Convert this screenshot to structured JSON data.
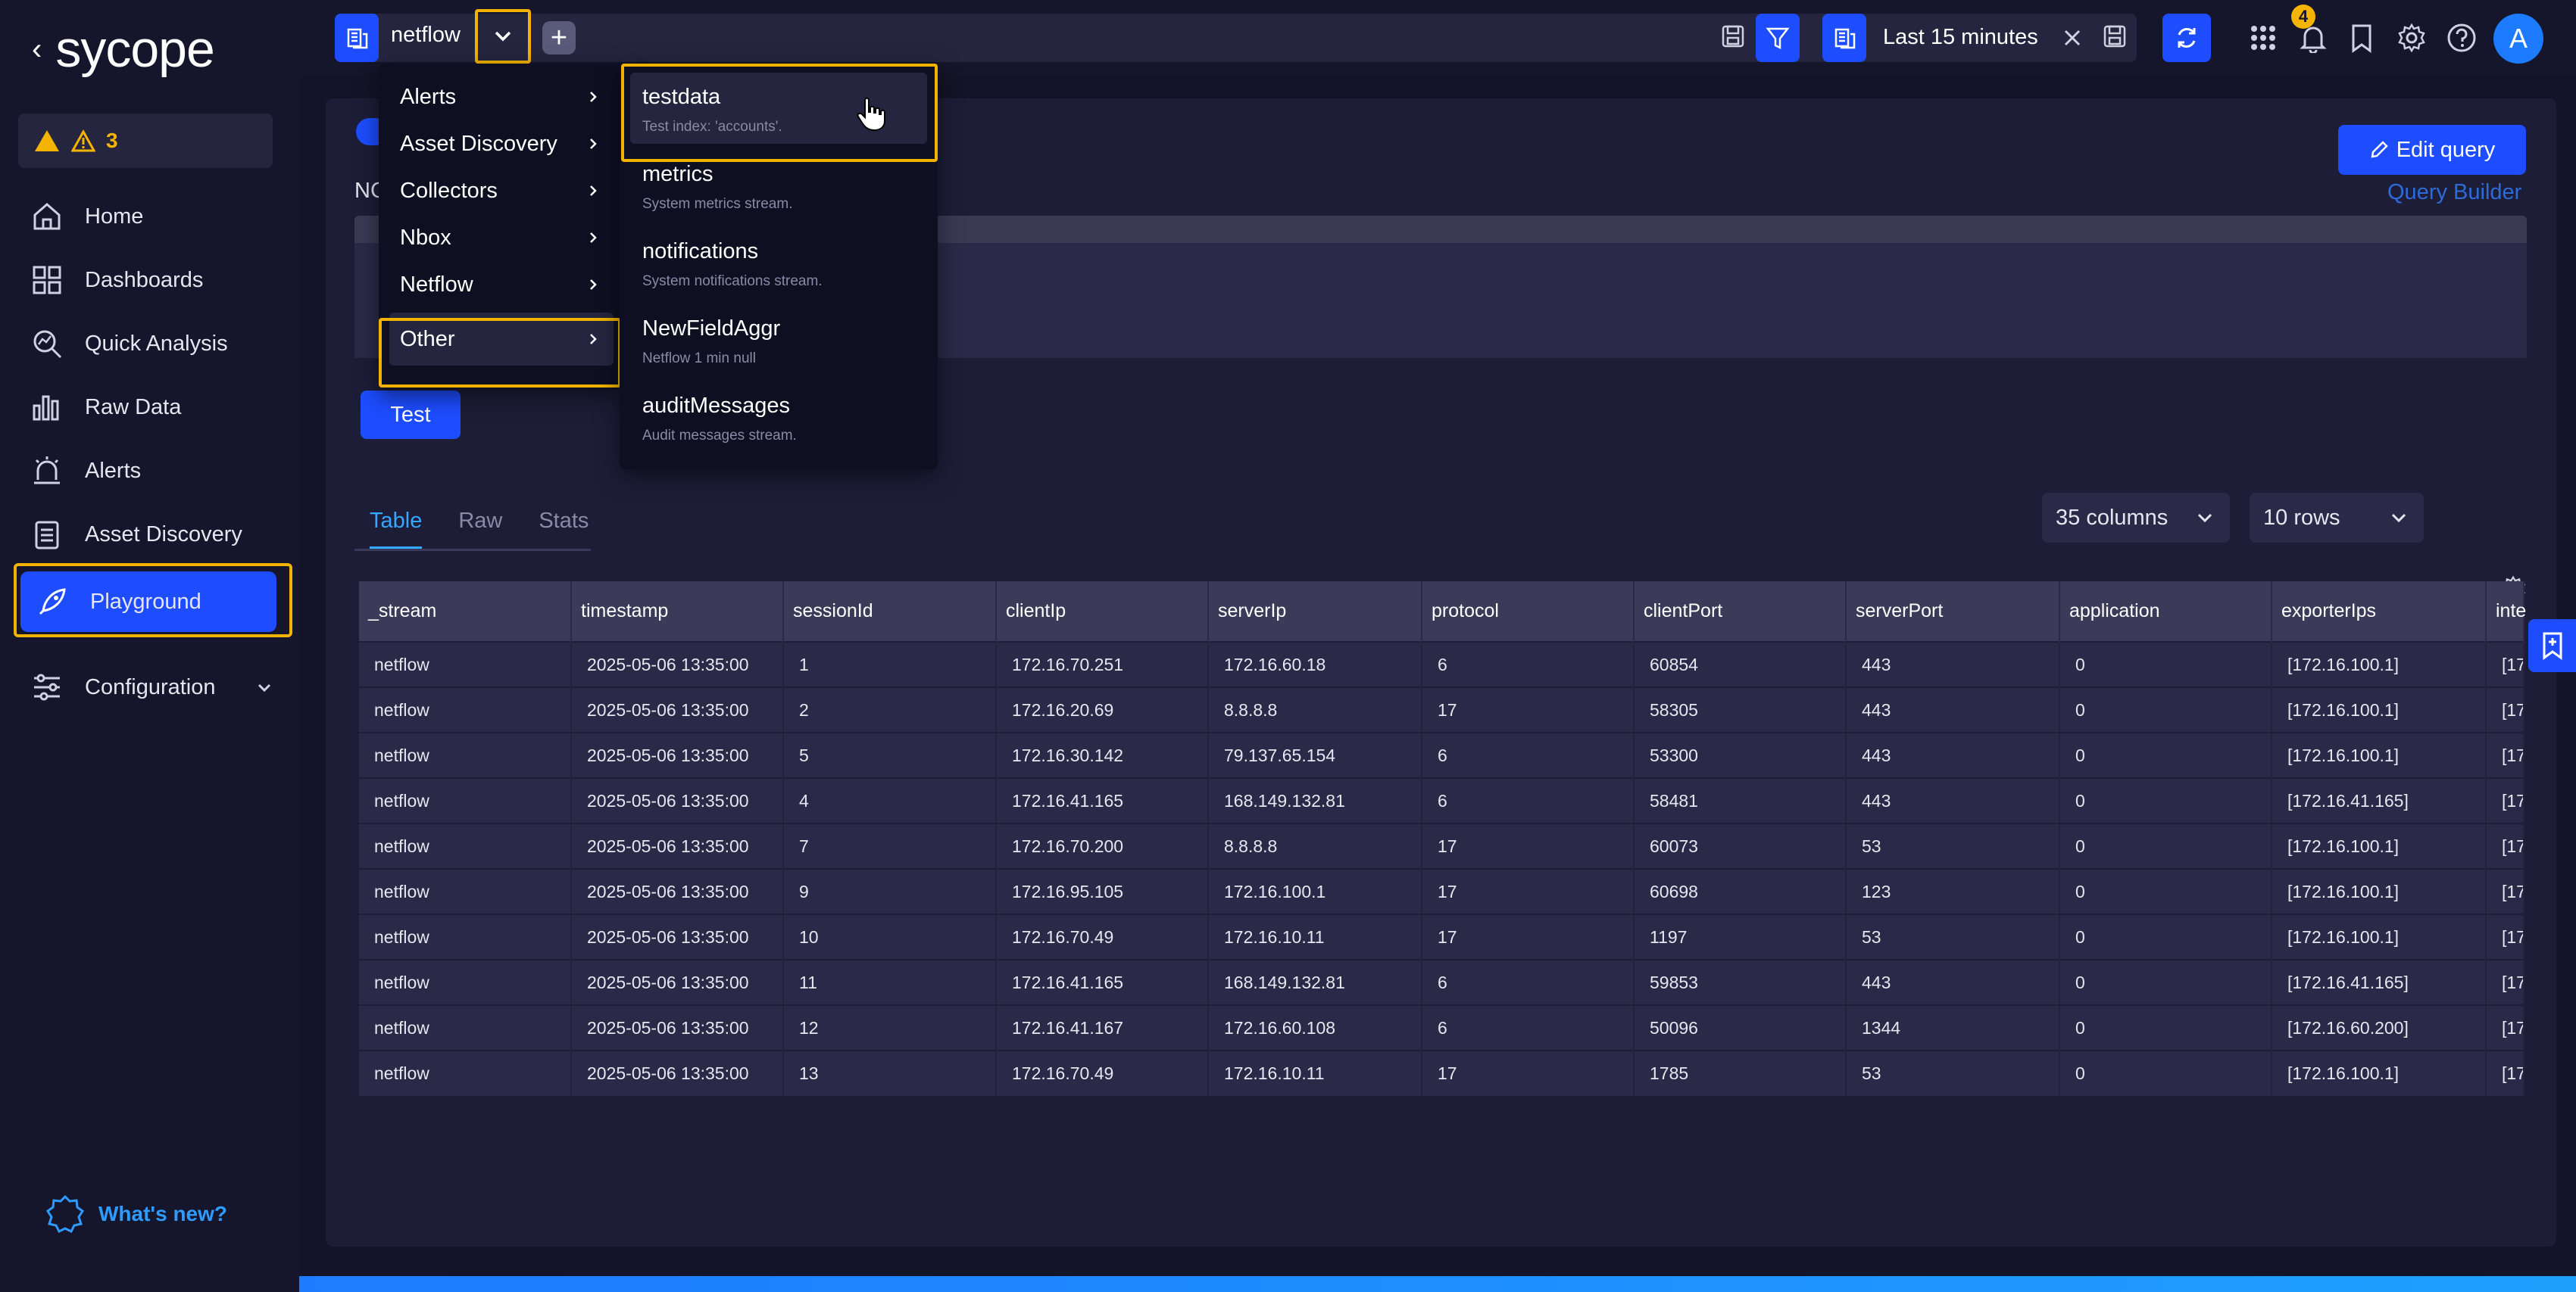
{
  "app": {
    "logo_text": "sycope",
    "back_glyph": "‹",
    "whats_new": "What's new?"
  },
  "alerts": {
    "count": "3"
  },
  "sidebar": {
    "items": [
      {
        "label": "Home",
        "icon": "home-icon"
      },
      {
        "label": "Dashboards",
        "icon": "dashboard-icon"
      },
      {
        "label": "Quick Analysis",
        "icon": "quick-analysis-icon"
      },
      {
        "label": "Raw Data",
        "icon": "raw-data-icon"
      },
      {
        "label": "Alerts",
        "icon": "alarm-icon"
      },
      {
        "label": "Asset Discovery",
        "icon": "clipboard-icon"
      },
      {
        "label": "Playground",
        "icon": "rocket-icon"
      },
      {
        "label": "Configuration",
        "icon": "sliders-icon"
      }
    ]
  },
  "topbar": {
    "stream": "netflow",
    "plus": "+",
    "time_range": "Last 15 minutes",
    "notifications": "4",
    "avatar": "A"
  },
  "menu_l1": [
    "Alerts",
    "Asset Discovery",
    "Collectors",
    "Nbox",
    "Netflow",
    "Other"
  ],
  "menu_l2": [
    {
      "title": "testdata",
      "desc": "Test index: 'accounts'."
    },
    {
      "title": "metrics",
      "desc": "System metrics stream."
    },
    {
      "title": "notifications",
      "desc": "System notifications stream."
    },
    {
      "title": "NewFieldAggr",
      "desc": "Netflow 1 min null"
    },
    {
      "title": "auditMessages",
      "desc": "Audit messages stream."
    }
  ],
  "main": {
    "no_label": "NC",
    "edit_query": "Edit query",
    "query_builder": "Query Builder",
    "test": "Test",
    "tabs": [
      "Table",
      "Raw",
      "Stats"
    ],
    "columns_select": "35 columns",
    "rows_select": "10 rows"
  },
  "table": {
    "headers": [
      "_stream",
      "timestamp",
      "sessionId",
      "clientIp",
      "serverIp",
      "protocol",
      "clientPort",
      "serverPort",
      "application",
      "exporterIps",
      "inte"
    ],
    "rows": [
      [
        "netflow",
        "2025-05-06 13:35:00",
        "1",
        "172.16.70.251",
        "172.16.60.18",
        "6",
        "60854",
        "443",
        "0",
        "[172.16.100.1]",
        "[172"
      ],
      [
        "netflow",
        "2025-05-06 13:35:00",
        "2",
        "172.16.20.69",
        "8.8.8.8",
        "17",
        "58305",
        "443",
        "0",
        "[172.16.100.1]",
        "[172"
      ],
      [
        "netflow",
        "2025-05-06 13:35:00",
        "5",
        "172.16.30.142",
        "79.137.65.154",
        "6",
        "53300",
        "443",
        "0",
        "[172.16.100.1]",
        "[172"
      ],
      [
        "netflow",
        "2025-05-06 13:35:00",
        "4",
        "172.16.41.165",
        "168.149.132.81",
        "6",
        "58481",
        "443",
        "0",
        "[172.16.41.165]",
        "[172"
      ],
      [
        "netflow",
        "2025-05-06 13:35:00",
        "7",
        "172.16.70.200",
        "8.8.8.8",
        "17",
        "60073",
        "53",
        "0",
        "[172.16.100.1]",
        "[172"
      ],
      [
        "netflow",
        "2025-05-06 13:35:00",
        "9",
        "172.16.95.105",
        "172.16.100.1",
        "17",
        "60698",
        "123",
        "0",
        "[172.16.100.1]",
        "[172"
      ],
      [
        "netflow",
        "2025-05-06 13:35:00",
        "10",
        "172.16.70.49",
        "172.16.10.11",
        "17",
        "1197",
        "53",
        "0",
        "[172.16.100.1]",
        "[172"
      ],
      [
        "netflow",
        "2025-05-06 13:35:00",
        "11",
        "172.16.41.165",
        "168.149.132.81",
        "6",
        "59853",
        "443",
        "0",
        "[172.16.41.165]",
        "[172"
      ],
      [
        "netflow",
        "2025-05-06 13:35:00",
        "12",
        "172.16.41.167",
        "172.16.60.108",
        "6",
        "50096",
        "1344",
        "0",
        "[172.16.60.200]",
        "[172"
      ],
      [
        "netflow",
        "2025-05-06 13:35:00",
        "13",
        "172.16.70.49",
        "172.16.10.11",
        "17",
        "1785",
        "53",
        "0",
        "[172.16.100.1]",
        "[172"
      ]
    ]
  },
  "colors": {
    "accent": "#1d4dff",
    "highlight": "#f2b200",
    "warning": "#f5b400",
    "link": "#2d6bd9"
  }
}
